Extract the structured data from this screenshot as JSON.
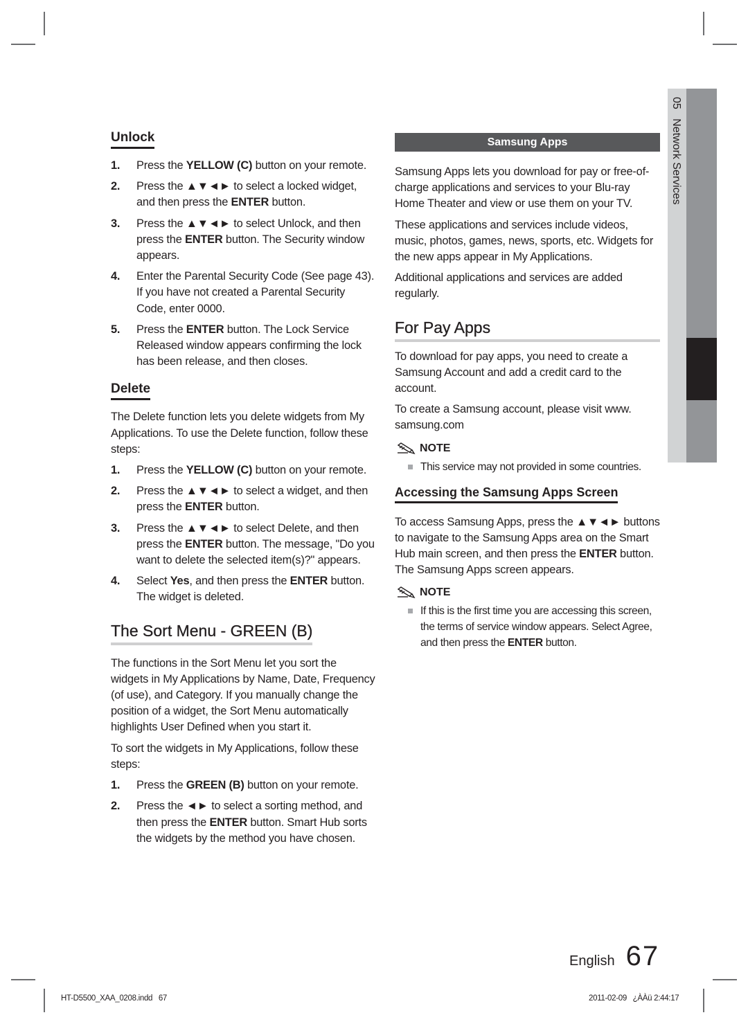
{
  "left_column": {
    "unlock": {
      "heading": "Unlock",
      "steps": [
        {
          "num": "1.",
          "segments": [
            [
              "Press the ",
              false
            ],
            [
              "YELLOW (C)",
              true
            ],
            [
              " button on your remote.",
              false
            ]
          ]
        },
        {
          "num": "2.",
          "segments": [
            [
              "Press the ▲▼◄► to select a locked widget, and then press the ",
              false
            ],
            [
              "ENTER",
              true
            ],
            [
              " button.",
              false
            ]
          ]
        },
        {
          "num": "3.",
          "segments": [
            [
              "Press the ▲▼◄► to select Unlock, and then press the ",
              false
            ],
            [
              "ENTER",
              true
            ],
            [
              " button. The Security window appears.",
              false
            ]
          ]
        },
        {
          "num": "4.",
          "segments": [
            [
              "Enter the Parental Security Code (See page 43). If you have not created a Parental Security Code, enter 0000.",
              false
            ]
          ]
        },
        {
          "num": "5.",
          "segments": [
            [
              "Press the ",
              false
            ],
            [
              "ENTER",
              true
            ],
            [
              " button. The Lock Service Released window appears confirming the lock has been release, and then closes.",
              false
            ]
          ]
        }
      ]
    },
    "delete": {
      "heading": "Delete",
      "intro": "The Delete function lets you delete widgets from My Applications. To use the Delete function, follow these steps:",
      "steps": [
        {
          "num": "1.",
          "segments": [
            [
              "Press the ",
              false
            ],
            [
              "YELLOW (C)",
              true
            ],
            [
              " button on your remote.",
              false
            ]
          ]
        },
        {
          "num": "2.",
          "segments": [
            [
              "Press the ▲▼◄► to select a widget, and then press the ",
              false
            ],
            [
              "ENTER",
              true
            ],
            [
              " button.",
              false
            ]
          ]
        },
        {
          "num": "3.",
          "segments": [
            [
              "Press the ▲▼◄► to select Delete, and then press the ",
              false
            ],
            [
              "ENTER",
              true
            ],
            [
              " button. The message, \"Do you want to delete the selected item(s)?\" appears.",
              false
            ]
          ]
        },
        {
          "num": "4.",
          "segments": [
            [
              "Select ",
              false
            ],
            [
              "Yes",
              true
            ],
            [
              ", and then press the ",
              false
            ],
            [
              "ENTER",
              true
            ],
            [
              " button. The widget is deleted.",
              false
            ]
          ]
        }
      ]
    },
    "sort_menu": {
      "heading": "The Sort Menu - GREEN (B)",
      "paragraphs": [
        "The functions in the Sort Menu let you sort the widgets in My Applications by Name, Date, Frequency (of use), and Category. If you manually change the position of a widget, the Sort Menu automatically highlights User Defined when you start it.",
        "To sort the widgets in My Applications, follow these steps:"
      ],
      "steps": [
        {
          "num": "1.",
          "segments": [
            [
              "Press the ",
              false
            ],
            [
              "GREEN (B)",
              true
            ],
            [
              " button on your remote.",
              false
            ]
          ]
        },
        {
          "num": "2.",
          "segments": [
            [
              "Press the ◄► to select a sorting method, and then press the ",
              false
            ],
            [
              "ENTER",
              true
            ],
            [
              " button. Smart Hub sorts the widgets by the method you have chosen.",
              false
            ]
          ]
        }
      ]
    }
  },
  "right_column": {
    "samsung_apps": {
      "band_title": "Samsung Apps",
      "paragraphs": [
        "Samsung Apps lets you download for pay or free-of-charge applications and services to your Blu-ray Home Theater and view or use them on your TV.",
        "These applications and services include videos, music, photos, games, news, sports, etc. Widgets for the new apps appear in My Applications.",
        "Additional applications and services are added regularly."
      ]
    },
    "for_pay_apps": {
      "heading": "For Pay Apps",
      "paragraphs": [
        "To download for pay apps, you need to create a Samsung Account and add a credit card to the account.",
        "To create a Samsung account, please visit www. samsung.com"
      ],
      "note": {
        "label": "NOTE",
        "icon": "pencil-note-icon",
        "items": [
          {
            "segments": [
              [
                "This service may not provided in some countries.",
                false
              ]
            ]
          }
        ]
      }
    },
    "accessing": {
      "heading": "Accessing the Samsung Apps Screen",
      "paragraph": [
        [
          "To access Samsung Apps, press the ▲▼◄► buttons to navigate to the Samsung Apps area on the Smart Hub main screen, and then press the ",
          false
        ],
        [
          "ENTER",
          true
        ],
        [
          " button. The Samsung Apps screen appears.",
          false
        ]
      ],
      "note": {
        "label": "NOTE",
        "icon": "pencil-note-icon",
        "items": [
          {
            "segments": [
              [
                "If this is the first time you are accessing this screen, the terms of service window appears. Select Agree, and then press the ",
                false
              ],
              [
                "ENTER",
                true
              ],
              [
                " button.",
                false
              ]
            ]
          }
        ]
      }
    }
  },
  "side_tab": {
    "chapter_number": "05",
    "chapter_title": "Network Services"
  },
  "footer": {
    "language": "English",
    "page_number": "67",
    "slug_left": "HT-D5500_XAA_0208.indd   67",
    "slug_right": "2011-02-09   ¿ÀÀü 2:44:17"
  },
  "colors": {
    "text": "#231f20",
    "band": "#58595b",
    "heading_rule": "#cfcfd0",
    "tab_light": "#d1d3d4",
    "tab_mid": "#939598",
    "tab_dark": "#231f20"
  }
}
